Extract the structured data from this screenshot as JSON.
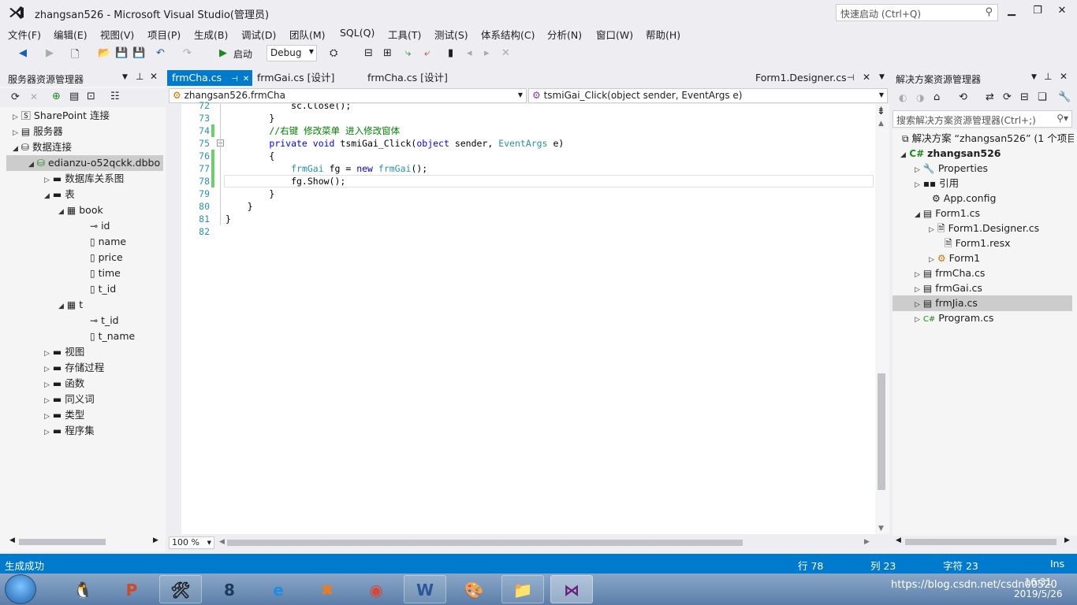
{
  "app": {
    "title": "zhangsan526 - Microsoft Visual Studio(管理员)",
    "quick_launch_placeholder": "快速启动 (Ctrl+Q)"
  },
  "menu": [
    "文件(F)",
    "编辑(E)",
    "视图(V)",
    "项目(P)",
    "生成(B)",
    "调试(D)",
    "团队(M)",
    "SQL(Q)",
    "工具(T)",
    "测试(S)",
    "体系结构(C)",
    "分析(N)",
    "窗口(W)",
    "帮助(H)"
  ],
  "toolbar": {
    "start_label": "启动",
    "config": "Debug"
  },
  "server_explorer": {
    "title": "服务器资源管理器",
    "items": [
      {
        "label": "SharePoint 连接",
        "icon": "sharepoint-icon"
      },
      {
        "label": "服务器",
        "icon": "server-icon"
      },
      {
        "label": "数据连接",
        "icon": "data-connection-icon"
      },
      {
        "label": "edianzu-o52qckk.dbbo",
        "icon": "database-icon"
      },
      {
        "label": "数据库关系图",
        "icon": "folder-icon"
      },
      {
        "label": "表",
        "icon": "folder-icon"
      },
      {
        "label": "book",
        "icon": "table-icon"
      },
      {
        "label": "id",
        "icon": "key-icon"
      },
      {
        "label": "name",
        "icon": "column-icon"
      },
      {
        "label": "price",
        "icon": "column-icon"
      },
      {
        "label": "time",
        "icon": "column-icon"
      },
      {
        "label": "t_id",
        "icon": "column-icon"
      },
      {
        "label": "t",
        "icon": "table-icon"
      },
      {
        "label": "t_id",
        "icon": "key-icon"
      },
      {
        "label": "t_name",
        "icon": "column-icon"
      },
      {
        "label": "视图",
        "icon": "folder-icon"
      },
      {
        "label": "存储过程",
        "icon": "folder-icon"
      },
      {
        "label": "函数",
        "icon": "folder-icon"
      },
      {
        "label": "同义词",
        "icon": "folder-icon"
      },
      {
        "label": "类型",
        "icon": "folder-icon"
      },
      {
        "label": "程序集",
        "icon": "folder-icon"
      }
    ]
  },
  "tabs": [
    {
      "label": "frmCha.cs",
      "active": true
    },
    {
      "label": "frmGai.cs [设计]"
    },
    {
      "label": "frmCha.cs [设计]"
    },
    {
      "label": "Form1.Designer.cs"
    }
  ],
  "nav": {
    "class": "zhangsan526.frmCha",
    "member": "tsmiGai_Click(object sender, EventArgs e)"
  },
  "code": {
    "lines": [
      {
        "n": "72",
        "text": "            sc.Close();"
      },
      {
        "n": "73",
        "text": "        }"
      },
      {
        "n": "74",
        "text": "        //右键 修改菜单 进入修改窗体"
      },
      {
        "n": "75",
        "text": "        private void tsmiGai_Click(object sender, EventArgs e)"
      },
      {
        "n": "76",
        "text": "        {"
      },
      {
        "n": "77",
        "text": "            frmGai fg = new frmGai();"
      },
      {
        "n": "78",
        "text": "            fg.Show();"
      },
      {
        "n": "79",
        "text": "        }"
      },
      {
        "n": "80",
        "text": "    }"
      },
      {
        "n": "81",
        "text": "}"
      },
      {
        "n": "82",
        "text": ""
      }
    ],
    "zoom": "100 %"
  },
  "solution_explorer": {
    "title": "解决方案资源管理器",
    "search_placeholder": "搜索解决方案资源管理器(Ctrl+;)",
    "items": [
      {
        "label": "解决方案 “zhangsan526” (1 个项目",
        "icon": "solution-icon"
      },
      {
        "label": "zhangsan526",
        "icon": "csharp-project-icon"
      },
      {
        "label": "Properties",
        "icon": "wrench-icon"
      },
      {
        "label": "引用",
        "icon": "reference-icon"
      },
      {
        "label": "App.config",
        "icon": "config-icon"
      },
      {
        "label": "Form1.cs",
        "icon": "form-icon"
      },
      {
        "label": "Form1.Designer.cs",
        "icon": "cs-file-icon"
      },
      {
        "label": "Form1.resx",
        "icon": "resx-icon"
      },
      {
        "label": "Form1",
        "icon": "class-icon"
      },
      {
        "label": "frmCha.cs",
        "icon": "form-icon"
      },
      {
        "label": "frmGai.cs",
        "icon": "form-icon"
      },
      {
        "label": "frmJia.cs",
        "icon": "form-icon"
      },
      {
        "label": "Program.cs",
        "icon": "csharp-file-icon"
      }
    ]
  },
  "status": {
    "message": "生成成功",
    "row": "行 78",
    "col": "列 23",
    "char": "字符 23",
    "mode": "Ins"
  },
  "taskbar": {
    "time": "16:31",
    "date": "2019/5/26",
    "watermark": "https://blog.csdn.net/csdn00520"
  },
  "colors": {
    "accent": "#007acc",
    "keyword": "#0000ff",
    "type": "#2b91af",
    "comment": "#008000"
  }
}
